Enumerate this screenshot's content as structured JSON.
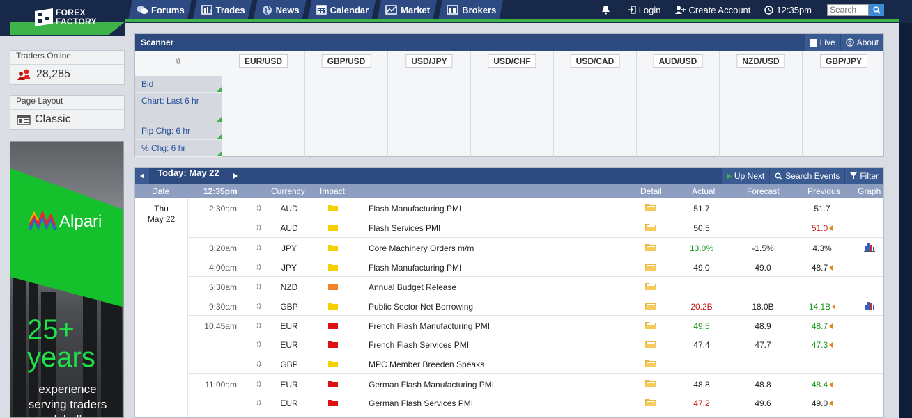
{
  "header": {
    "logo_line1": "FOREX",
    "logo_line2": "FACTORY",
    "nav": [
      "Forums",
      "Trades",
      "News",
      "Calendar",
      "Market",
      "Brokers"
    ],
    "login": "Login",
    "create_account": "Create Account",
    "clock": "12:35pm",
    "search_placeholder": "Search"
  },
  "sidebar": {
    "traders_online_label": "Traders Online",
    "traders_online_value": "28,285",
    "page_layout_label": "Page Layout",
    "page_layout_value": "Classic",
    "ad": {
      "brand": "Alpari",
      "headline1": "25+",
      "headline2": "years",
      "line1": "experience",
      "line2": "serving traders",
      "line3": "globally"
    }
  },
  "scanner": {
    "title": "Scanner",
    "live_label": "Live",
    "about_label": "About",
    "rows": [
      "Bid",
      "Chart: Last 6 hr",
      "Pip Chg: 6 hr",
      "% Chg: 6 hr"
    ],
    "pairs": [
      "EUR/USD",
      "GBP/USD",
      "USD/JPY",
      "USD/CHF",
      "USD/CAD",
      "AUD/USD",
      "NZD/USD",
      "GBP/JPY"
    ]
  },
  "calendar": {
    "today_label": "Today: May 22",
    "up_next": "Up Next",
    "search_events": "Search Events",
    "filter": "Filter",
    "columns": {
      "date": "Date",
      "time": "12:35pm",
      "currency": "Currency",
      "impact": "Impact",
      "detail": "Detail",
      "actual": "Actual",
      "forecast": "Forecast",
      "previous": "Previous",
      "graph": "Graph"
    },
    "day_line1": "Thu",
    "day_line2": "May 22",
    "events": [
      {
        "time": "2:30am",
        "currency": "AUD",
        "impact": "yellow",
        "event": "Flash Manufacturing PMI",
        "actual": "51.7",
        "actual_color": "",
        "forecast": "",
        "previous": "51.7",
        "previous_color": "",
        "revised": false,
        "graph": false,
        "sep": false
      },
      {
        "time": "",
        "currency": "AUD",
        "impact": "yellow",
        "event": "Flash Services PMI",
        "actual": "50.5",
        "actual_color": "",
        "forecast": "",
        "previous": "51.0",
        "previous_color": "red",
        "revised": true,
        "graph": false,
        "sep": false
      },
      {
        "time": "3:20am",
        "currency": "JPY",
        "impact": "yellow",
        "event": "Core Machinery Orders m/m",
        "actual": "13.0%",
        "actual_color": "green",
        "forecast": "-1.5%",
        "previous": "4.3%",
        "previous_color": "",
        "revised": false,
        "graph": true,
        "sep": true
      },
      {
        "time": "4:00am",
        "currency": "JPY",
        "impact": "yellow",
        "event": "Flash Manufacturing PMI",
        "actual": "49.0",
        "actual_color": "",
        "forecast": "49.0",
        "previous": "48.7",
        "previous_color": "",
        "revised": true,
        "graph": false,
        "sep": true
      },
      {
        "time": "5:30am",
        "currency": "NZD",
        "impact": "orange",
        "event": "Annual Budget Release",
        "actual": "",
        "actual_color": "",
        "forecast": "",
        "previous": "",
        "previous_color": "",
        "revised": false,
        "graph": false,
        "sep": true
      },
      {
        "time": "9:30am",
        "currency": "GBP",
        "impact": "yellow",
        "event": "Public Sector Net Borrowing",
        "actual": "20.2B",
        "actual_color": "red",
        "forecast": "18.0B",
        "previous": "14.1B",
        "previous_color": "green",
        "revised": true,
        "graph": true,
        "sep": true
      },
      {
        "time": "10:45am",
        "currency": "EUR",
        "impact": "red",
        "event": "French Flash Manufacturing PMI",
        "actual": "49.5",
        "actual_color": "green",
        "forecast": "48.9",
        "previous": "48.7",
        "previous_color": "green",
        "revised": true,
        "graph": false,
        "sep": true
      },
      {
        "time": "",
        "currency": "EUR",
        "impact": "red",
        "event": "French Flash Services PMI",
        "actual": "47.4",
        "actual_color": "",
        "forecast": "47.7",
        "previous": "47.3",
        "previous_color": "green",
        "revised": true,
        "graph": false,
        "sep": false
      },
      {
        "time": "",
        "currency": "GBP",
        "impact": "yellow",
        "event": "MPC Member Breeden Speaks",
        "actual": "",
        "actual_color": "",
        "forecast": "",
        "previous": "",
        "previous_color": "",
        "revised": false,
        "graph": false,
        "sep": false
      },
      {
        "time": "11:00am",
        "currency": "EUR",
        "impact": "red",
        "event": "German Flash Manufacturing PMI",
        "actual": "48.8",
        "actual_color": "",
        "forecast": "48.8",
        "previous": "48.4",
        "previous_color": "green",
        "revised": true,
        "graph": false,
        "sep": true
      },
      {
        "time": "",
        "currency": "EUR",
        "impact": "red",
        "event": "German Flash Services PMI",
        "actual": "47.2",
        "actual_color": "red",
        "forecast": "49.6",
        "previous": "49.0",
        "previous_color": "",
        "revised": true,
        "graph": false,
        "sep": false
      }
    ]
  },
  "colors": {
    "header_bg": "#182848",
    "nav_tab": "#2e4a83",
    "brand_green": "#3db34a",
    "panel_head": "#2c4a7e",
    "impact_yellow": "#f4d000",
    "impact_orange": "#f0842c",
    "impact_red": "#e01010"
  }
}
